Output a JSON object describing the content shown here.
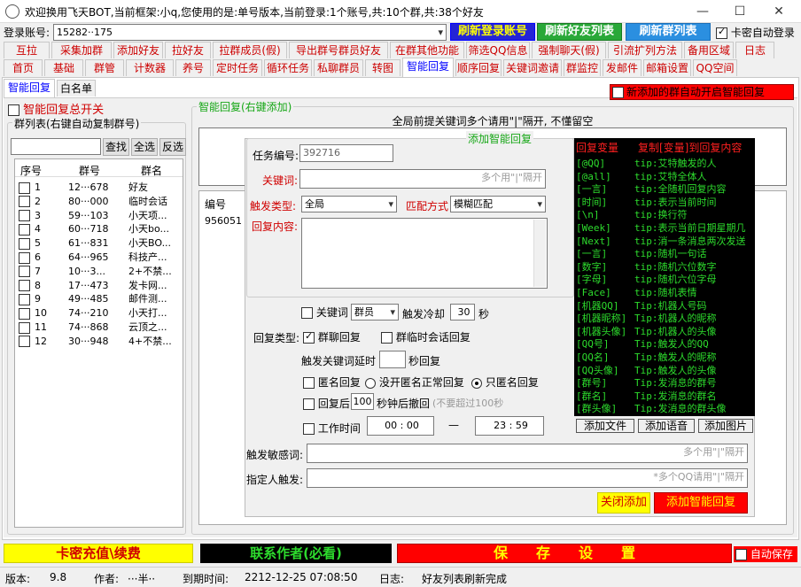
{
  "window": {
    "title": "欢迎换用飞天BOT,当前框架:小q,您使用的是:单号版本,当前登录:1个账号,共:10个群,共:38个好友",
    "min": "—",
    "max": "☐",
    "close": "✕"
  },
  "login": {
    "label": "登录账号:",
    "account": "15282··175",
    "btn_refresh_login": "刷新登录账号",
    "btn_refresh_friends": "刷新好友列表",
    "btn_refresh_groups": "刷新群列表",
    "auto_login": "卡密自动登录"
  },
  "tabs_row1": [
    "互拉",
    "采集加群",
    "添加好友",
    "拉好友",
    "拉群成员(假)",
    "导出群号群员好友",
    "在群其他功能",
    "筛选QQ信息",
    "强制聊天(假)",
    "引流扩列方法",
    "备用区域",
    "日志"
  ],
  "tabs_row2": [
    "首页",
    "基础",
    "群管",
    "计数器",
    "养号",
    "定时任务",
    "循环任务",
    "私聊群员",
    "转图",
    "智能回复",
    "顺序回复",
    "关键词邀请",
    "群监控",
    "发邮件",
    "邮箱设置",
    "QQ空间"
  ],
  "subtabs": [
    "智能回复",
    "白名单"
  ],
  "toggle_main": "智能回复总开关",
  "group_list": {
    "legend": "群列表(右键自动复制群号)",
    "search": "查找",
    "select_all": "全选",
    "invert": "反选",
    "cols": [
      "序号",
      "群号",
      "群名"
    ],
    "rows": [
      [
        "1",
        "12···678",
        "好友"
      ],
      [
        "2",
        "80···000",
        "临时会话"
      ],
      [
        "3",
        "59···103",
        "小天项..."
      ],
      [
        "4",
        "60···718",
        "小天bo..."
      ],
      [
        "5",
        "61···831",
        "小天BO..."
      ],
      [
        "6",
        "64···965",
        "科技产..."
      ],
      [
        "7",
        "10···3...",
        "2+不禁..."
      ],
      [
        "8",
        "17···473",
        "发卡网..."
      ],
      [
        "9",
        "49···485",
        "邮件测..."
      ],
      [
        "10",
        "74···210",
        "小天打..."
      ],
      [
        "11",
        "74···868",
        "云顶之..."
      ],
      [
        "12",
        "30···948",
        "4+不禁..."
      ]
    ]
  },
  "banner_red": "新添加的群自动开启智能回复",
  "reply_group": {
    "legend": "智能回复(右键添加)",
    "global_kw": "全局前提关键词多个请用\"|\"隔开, 不懂留空",
    "table_col": "编号",
    "table_val": "956051"
  },
  "add_form": {
    "legend": "添加智能回复",
    "task_label": "任务编号:",
    "task_value": "392716",
    "kw_label": "关键词:",
    "kw_placeholder": "多个用\"|\"隔开",
    "trigger_label": "触发类型:",
    "trigger_value": "全局",
    "match_label": "匹配方式",
    "match_value": "模糊匹配",
    "content_label": "回复内容:",
    "kw_chk": "关键词",
    "kw_role": "群员",
    "cooldown_label": "触发冷却",
    "cooldown_value": "30",
    "sec": "秒",
    "reply_type_label": "回复类型:",
    "group_chat_reply": "群聊回复",
    "temp_reply": "群临时会话回复",
    "delay_label": "触发关键词延时",
    "delay_unit": "秒回复",
    "anon_label": "匿名回复",
    "anon_opt1": "没开匿名正常回复",
    "anon_opt2": "只匿名回复",
    "recall_label": "回复后",
    "recall_value": "100",
    "recall_unit": "秒钟后撤回",
    "recall_hint": "(不要超过100秒",
    "worktime_label": "工作时间",
    "t1": "00 : 00",
    "dash": "—",
    "t2": "23 : 59",
    "sensitive_label": "触发敏感词:",
    "sensitive_ph": "多个用\"|\"隔开",
    "person_label": "指定人触发:",
    "person_ph": "*多个QQ请用\"|\"隔开",
    "btn_close": "关闭添加",
    "btn_add": "添加智能回复"
  },
  "vars": {
    "header_a": "回复变量",
    "header_b": "复制[变量]到回复内容",
    "items": [
      [
        "[@QQ]",
        "tip:艾特触发的人"
      ],
      [
        "[@all]",
        "tip:艾特全体人"
      ],
      [
        "[一言]",
        "tip:全随机回复内容"
      ],
      [
        "[时间]",
        "tip:表示当前时间"
      ],
      [
        "[\\n]",
        "tip:换行符"
      ],
      [
        "[Week]",
        "tip:表示当前日期星期几"
      ],
      [
        "[Next]",
        "tip:消一条消息两次发送"
      ],
      [
        "[一言]",
        "tip:随机一句话"
      ],
      [
        "[数字]",
        "tip:随机六位数字"
      ],
      [
        "[字母]",
        "tip:随机六位字母"
      ],
      [
        "[Face]",
        "tip:随机表情"
      ],
      [
        "[机器QQ]",
        "Tip:机器人号码"
      ],
      [
        "[机器昵称]",
        "Tip:机器人的昵称"
      ],
      [
        "[机器头像]",
        "Tip:机器人的头像"
      ],
      [
        "[QQ号]",
        "Tip:触发人的QQ"
      ],
      [
        "[QQ名]",
        "Tip:触发人的昵称"
      ],
      [
        "[QQ头像]",
        "Tip:触发人的头像"
      ],
      [
        "[群号]",
        "Tip:发消息的群号"
      ],
      [
        "[群名]",
        "Tip:发消息的群名"
      ],
      [
        "[群头像]",
        "Tip:发消息的群头像"
      ]
    ],
    "btn_file": "添加文件",
    "btn_voice": "添加语音",
    "btn_image": "添加图片"
  },
  "bottom": {
    "recharge": "卡密充值\\续费",
    "contact": "联系作者(必看)",
    "save": "保　　存　　设　　置",
    "autosave": "自动保存"
  },
  "status": {
    "ver_label": "版本:",
    "ver": "9.8",
    "author_label": "作者:",
    "author": "···半··",
    "expire_label": "到期时间:",
    "expire": "2212-12-25 07:08:50",
    "log_label": "日志:",
    "log": "好友列表刷新完成"
  }
}
